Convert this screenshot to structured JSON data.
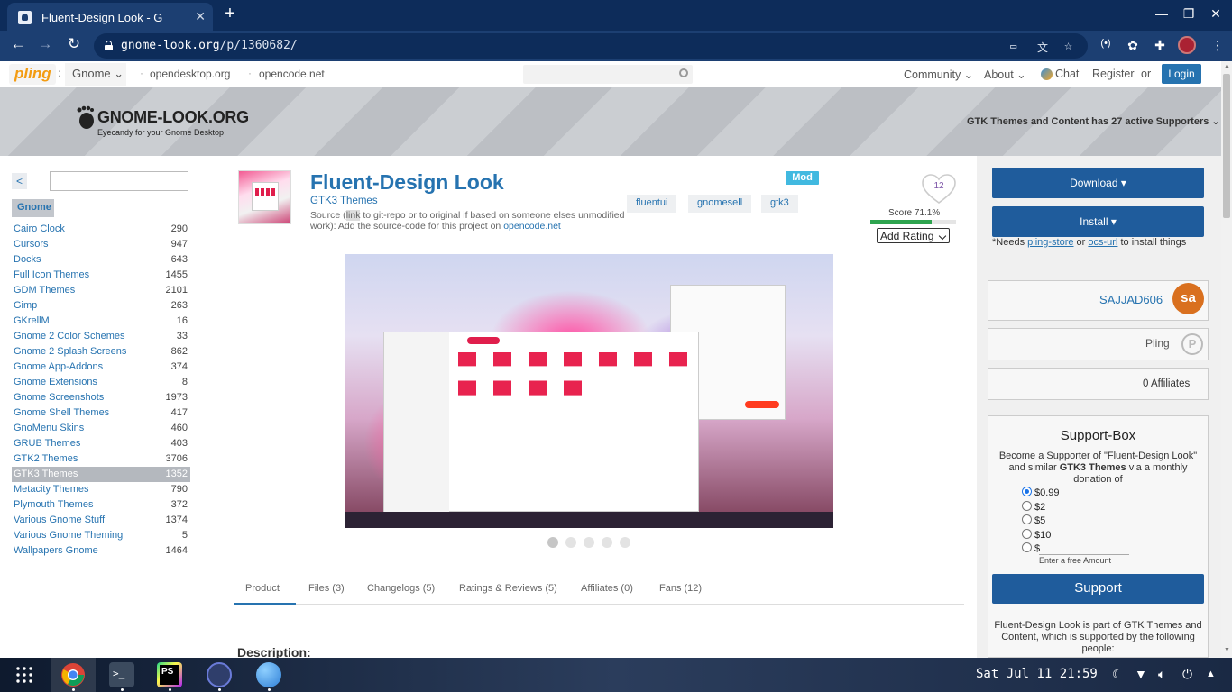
{
  "browser": {
    "tab_title": "Fluent-Design Look - G",
    "tab_close": "✕",
    "new_tab": "+",
    "url_host": "gnome-look.org",
    "url_path": "/p/1360682/",
    "back": "←",
    "forward": "→",
    "reload": "↻"
  },
  "sitenav": {
    "logo": "pling",
    "category_dropdown": "Gnome ⌄",
    "links": [
      "opendesktop.org",
      "opencode.net"
    ],
    "community": "Community ⌄",
    "about": "About ⌄",
    "chat": "Chat",
    "register": "Register",
    "or": "or",
    "login": "Login"
  },
  "header": {
    "logo_title": "GNOME-LOOK.ORG",
    "logo_subtitle": "Eyecandy for your Gnome Desktop",
    "supporters": "GTK Themes and Content has 27 active Supporters ⌄"
  },
  "sidebar": {
    "back": "<",
    "root": "Gnome",
    "categories": [
      {
        "label": "Cairo Clock",
        "count": "290"
      },
      {
        "label": "Cursors",
        "count": "947"
      },
      {
        "label": "Docks",
        "count": "643"
      },
      {
        "label": "Full Icon Themes",
        "count": "1455"
      },
      {
        "label": "GDM Themes",
        "count": "2101"
      },
      {
        "label": "Gimp",
        "count": "263"
      },
      {
        "label": "GKrellM",
        "count": "16"
      },
      {
        "label": "Gnome 2 Color Schemes",
        "count": "33"
      },
      {
        "label": "Gnome 2 Splash Screens",
        "count": "862"
      },
      {
        "label": "Gnome App-Addons",
        "count": "374"
      },
      {
        "label": "Gnome Extensions",
        "count": "8"
      },
      {
        "label": "Gnome Screenshots",
        "count": "1973"
      },
      {
        "label": "Gnome Shell Themes",
        "count": "417"
      },
      {
        "label": "GnoMenu Skins",
        "count": "460"
      },
      {
        "label": "GRUB Themes",
        "count": "403"
      },
      {
        "label": "GTK2 Themes",
        "count": "3706"
      },
      {
        "label": "GTK3 Themes",
        "count": "1352",
        "active": true
      },
      {
        "label": "Metacity Themes",
        "count": "790"
      },
      {
        "label": "Plymouth Themes",
        "count": "372"
      },
      {
        "label": "Various Gnome Stuff",
        "count": "1374"
      },
      {
        "label": "Various Gnome Theming",
        "count": "5"
      },
      {
        "label": "Wallpapers Gnome",
        "count": "1464"
      }
    ]
  },
  "product": {
    "title": "Fluent-Design Look",
    "category": "GTK3 Themes",
    "source_pre": "Source (",
    "source_link": "link",
    "source_mid": " to git-repo or to original if based on someone elses unmodified work): Add the source-code for this project on ",
    "source_site": "opencode.net",
    "mod_badge": "Mod",
    "tags": [
      "fluentui",
      "gnomesell",
      "gtk3"
    ],
    "likes": "12",
    "score_text": "Score 71.1%",
    "score_fraction": 0.711,
    "add_rating": "Add Rating",
    "carousel_active": 0,
    "carousel_count": 5
  },
  "tabs": [
    {
      "label": "Product",
      "active": true
    },
    {
      "label": "Files (3)"
    },
    {
      "label": "Changelogs (5)"
    },
    {
      "label": "Ratings & Reviews (5)"
    },
    {
      "label": "Affiliates (0)"
    },
    {
      "label": "Fans (12)"
    }
  ],
  "description_heading": "Description:",
  "right": {
    "download": "Download ▾",
    "install": "Install ▾",
    "needs_pre": "*Needs ",
    "needs_link1": "pling-store",
    "needs_or": " or ",
    "needs_link2": "ocs-url",
    "needs_post": " to install things",
    "username": "SAJJAD606",
    "avatar_initials": "sa",
    "pling": "Pling",
    "affiliates": "0 Affiliates",
    "supportbox_title": "Support-Box",
    "supportbox_text_1": "Become a Supporter of \"Fluent-Design Look\" and similar ",
    "supportbox_text_bold": "GTK3 Themes",
    "supportbox_text_2": " via a monthly donation of",
    "options": [
      "$0.99",
      "$2",
      "$5",
      "$10",
      "$"
    ],
    "free_amount": "Enter a free Amount",
    "support_button": "Support",
    "part_of": "Fluent-Design Look is part of GTK Themes and Content, which is supported by the following people:"
  },
  "taskbar": {
    "clock": "Sat Jul 11  21:59"
  },
  "colors": {
    "accent": "#2673b0",
    "browser_frame": "#0d2c5a",
    "button_blue": "#1f5c9c",
    "avatar_orange": "#d9701f",
    "mod_badge": "#41b9e0"
  },
  "icons": [
    "search-icon",
    "lock-icon",
    "heart-icon",
    "chevron-down-icon",
    "menu-icon",
    "extensions-icon",
    "chat-icon",
    "pling-icon",
    "apps-grid-icon",
    "moon-icon",
    "wifi-icon",
    "volume-icon",
    "power-icon"
  ]
}
